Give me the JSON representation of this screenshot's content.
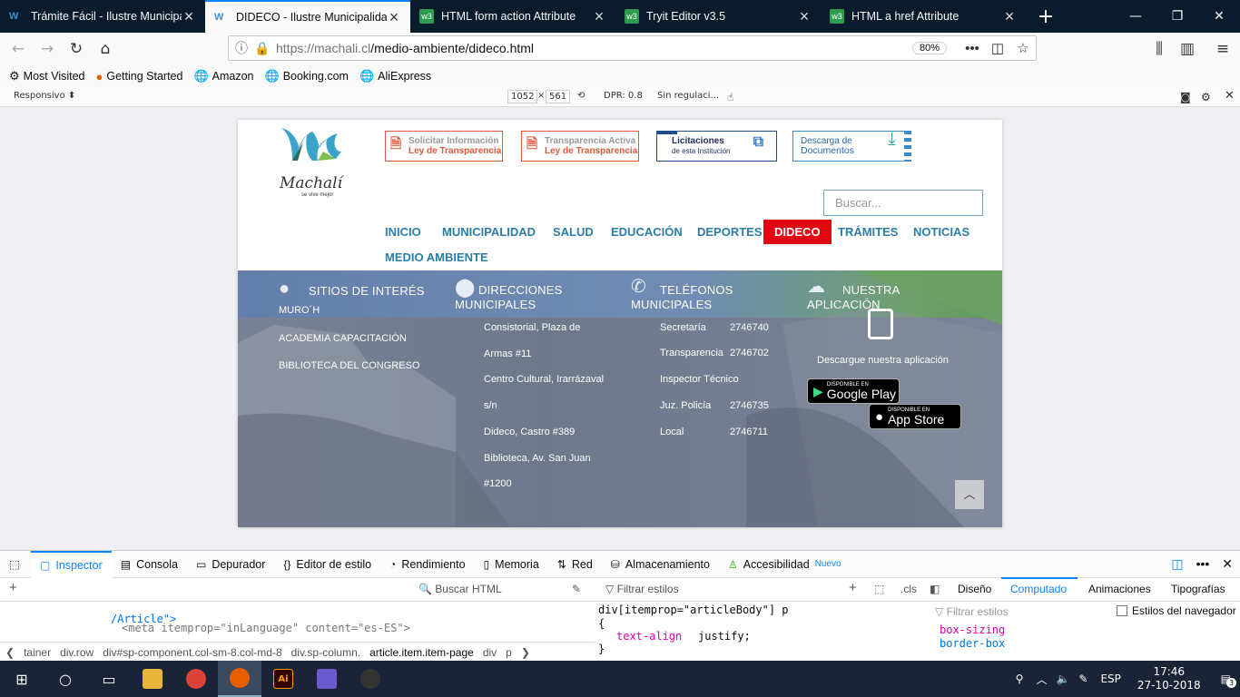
{
  "tabs": [
    {
      "title": "Trámite Fácil - Ilustre Municipa",
      "active": false,
      "favicon": "machali"
    },
    {
      "title": "DIDECO - Ilustre Municipalidad",
      "active": true,
      "favicon": "machali"
    },
    {
      "title": "HTML form action Attribute",
      "active": false,
      "favicon": "w3"
    },
    {
      "title": "Tryit Editor v3.5",
      "active": false,
      "favicon": "w3"
    },
    {
      "title": "HTML a href Attribute",
      "active": false,
      "favicon": "w3"
    }
  ],
  "urlbar": {
    "prefix": "https://machali.cl",
    "path": "/medio-ambiente/dideco.html",
    "zoom": "80%"
  },
  "bookmarks": [
    {
      "label": "Most Visited",
      "icon": "gear-icon"
    },
    {
      "label": "Getting Started",
      "icon": "firefox-icon"
    },
    {
      "label": "Amazon",
      "icon": "globe-icon"
    },
    {
      "label": "Booking.com",
      "icon": "globe-icon"
    },
    {
      "label": "AliExpress",
      "icon": "globe-icon"
    }
  ],
  "rdm": {
    "mode": "Responsivo",
    "width": "1052",
    "x": "×",
    "height": "561",
    "dpr": "DPR: 0.8",
    "throttle": "Sin regulaci..."
  },
  "site": {
    "logo_text": "Machalí",
    "logo_tag": "se vive mejor",
    "top_buttons": [
      {
        "line1": "Solicitar Información",
        "line2": "Ley de Transparencia"
      },
      {
        "line1": "Transparencia Activa",
        "line2": "Ley de Transparencia"
      },
      {
        "line1": "Licitaciones",
        "line2": "de esta Institución"
      },
      {
        "line1": "Descarga de",
        "line2": "Documentos"
      }
    ],
    "search_placeholder": "Buscar...",
    "nav": [
      "INICIO",
      "MUNICIPALIDAD",
      "SALUD",
      "EDUCACIÓN",
      "DEPORTES",
      "DIDECO",
      "TRÁMITES",
      "NOTICIAS",
      "MEDIO AMBIENTE"
    ],
    "nav_active": "DIDECO",
    "footer": {
      "sitios": {
        "title": "SITIOS DE INTERÉS",
        "items": [
          "MURO´H",
          "ACADEMIA CAPACITACIÓN",
          "BIBLIOTECA DEL CONGRESO"
        ]
      },
      "direcciones": {
        "title1": "DIRECCIONES",
        "title2": "MUNICIPALES",
        "items": [
          "Consistorial, Plaza de",
          "Armas #11",
          "Centro Cultural, Irarrázaval",
          "s/n",
          "Dideco, Castro #389",
          "Biblioteca, Av. San Juan",
          "#1200"
        ]
      },
      "telefonos": {
        "title1": "TELÉFONOS",
        "title2": "MUNICIPALES",
        "rows": [
          {
            "label": "Secretaría",
            "value": "2746740"
          },
          {
            "label": "Transparencia",
            "value": "2746702"
          },
          {
            "label": "Inspector Técnico",
            "value": ""
          },
          {
            "label": "Juz. Policía",
            "value": "2746735"
          },
          {
            "label": "Local",
            "value": "2746711"
          }
        ]
      },
      "app": {
        "title1": "NUESTRA",
        "title2": "APLICACIÓN",
        "text": "Descargue nuestra aplicación",
        "google_small": "DISPONIBLE EN",
        "google_big": "Google Play",
        "apple_small": "DISPONIBLE EN",
        "apple_big": "App Store"
      }
    }
  },
  "devtools": {
    "tabs": [
      "Inspector",
      "Consola",
      "Depurador",
      "Editor de estilo",
      "Rendimiento",
      "Memoria",
      "Red",
      "Almacenamiento",
      "Accesibilidad"
    ],
    "nuevo": "Nuevo",
    "search_html": "Buscar HTML",
    "filter_styles": "Filtrar estilos",
    "cls": ".cls",
    "right_tabs": [
      "Diseño",
      "Computado",
      "Animaciones",
      "Tipografías"
    ],
    "filter_styles2": "Filtrar estilos",
    "browser_styles": "Estilos del navegador",
    "html_line1": "/Article\">",
    "html_line2": "<meta itemprop=\"inLanguage\" content=\"es-ES\">",
    "css_selector": "div[itemprop=\"articleBody\"] p",
    "css_open": "{",
    "css_prop": "text-align",
    "css_value": "justify;",
    "css_close": "}",
    "computed_prop": "box-sizing",
    "computed_val": "border-box",
    "crumbs": [
      "tainer",
      "div.row",
      "div#sp-component.col-sm-8.col-md-8",
      "div.sp-column.",
      "article.item.item-page",
      "div",
      "p"
    ]
  },
  "taskbar": {
    "lang": "ESP",
    "time": "17:46",
    "date": "27-10-2018",
    "notif": "3"
  }
}
